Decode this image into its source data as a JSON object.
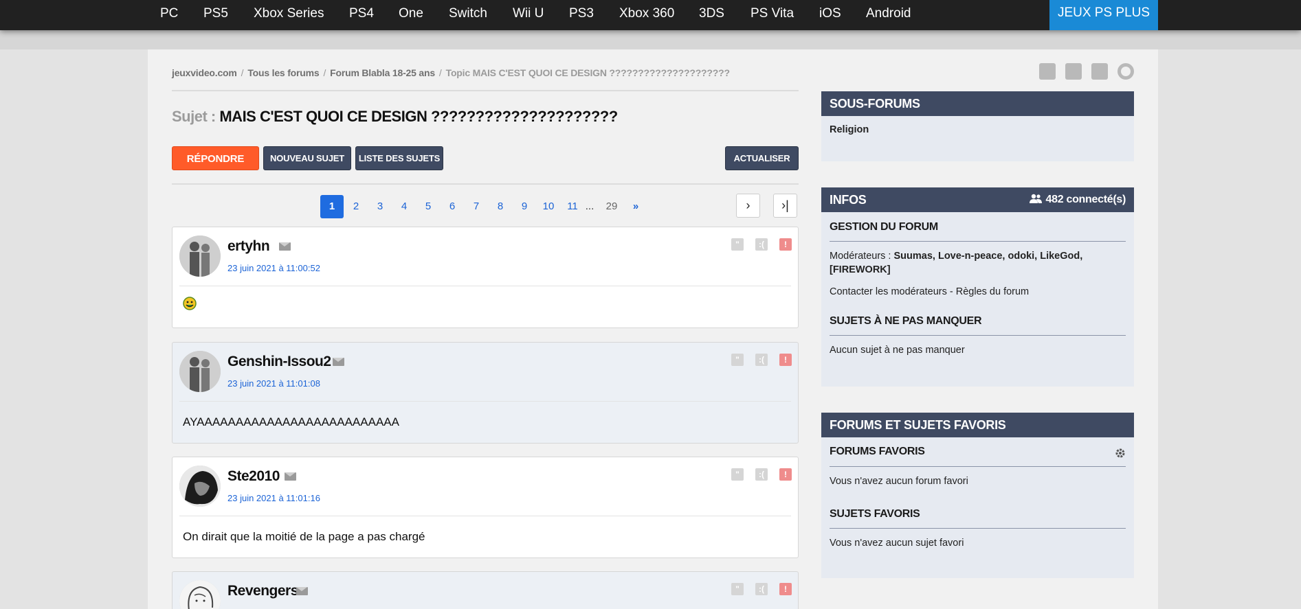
{
  "nav": {
    "items": [
      "PC",
      "PS5",
      "Xbox Series",
      "PS4",
      "One",
      "Switch",
      "Wii U",
      "PS3",
      "Xbox 360",
      "3DS",
      "PS Vita",
      "iOS",
      "Android"
    ],
    "promo": "JEUX PS PLUS"
  },
  "breadcrumb": {
    "home": "jeuxvideo.com",
    "forums": "Tous les forums",
    "forum": "Forum Blabla 18-25 ans",
    "topic": "Topic MAIS C'EST QUOI CE DESIGN ?????????????????????"
  },
  "subject": {
    "label": "Sujet :",
    "title": "MAIS C'EST QUOI CE DESIGN ?????????????????????"
  },
  "buttons": {
    "reply": "RÉPONDRE",
    "new_topic": "NOUVEAU SUJET",
    "topic_list": "LISTE DES SUJETS",
    "refresh": "ACTUALISER"
  },
  "pagination": {
    "pages": [
      "1",
      "2",
      "3",
      "4",
      "5",
      "6",
      "7",
      "8",
      "9",
      "10",
      "11"
    ],
    "dots": "...",
    "last": "29",
    "next": "»",
    "current": 1
  },
  "posts": [
    {
      "author": "ertyhn",
      "date": "23 juin 2021 à 11:00:52",
      "content": ""
    },
    {
      "author": "Genshin-Issou2",
      "date": "23 juin 2021 à 11:01:08",
      "content": "AYAAAAAAAAAAAAAAAAAAAAAAAAAA"
    },
    {
      "author": "Ste2010",
      "date": "23 juin 2021 à 11:01:16",
      "content": "On dirait que la moitié de la page a pas chargé"
    },
    {
      "author": "Revengers",
      "date": "",
      "content": ""
    }
  ],
  "sidebar": {
    "subforums": {
      "title": "SOUS-FORUMS",
      "items": [
        "Religion"
      ]
    },
    "infos": {
      "title": "INFOS",
      "connected": "482 connecté(s)",
      "gestion_title": "GESTION DU FORUM",
      "moderators_label": "Modérateurs :",
      "moderators": "Suumas, Love-n-peace, odoki, LikeGod,",
      "moderators_2": "[FIREWORK]",
      "contact": "Contacter les modérateurs - Règles du forum",
      "must_title": "SUJETS À NE PAS MANQUER",
      "must_text": "Aucun sujet à ne pas manquer"
    },
    "favorites": {
      "title": "FORUMS ET SUJETS FAVORIS",
      "forums_title": "FORUMS FAVORIS",
      "forums_text": "Vous n'avez aucun forum favori",
      "topics_title": "SUJETS FAVORIS",
      "topics_text": "Vous n'avez aucun sujet favori"
    }
  },
  "colors": {
    "accent": "#ff5b29",
    "nav_bg": "#212121",
    "promo": "#1a8ad6",
    "panel_header": "#3f4a62",
    "link": "#1b63d6"
  }
}
